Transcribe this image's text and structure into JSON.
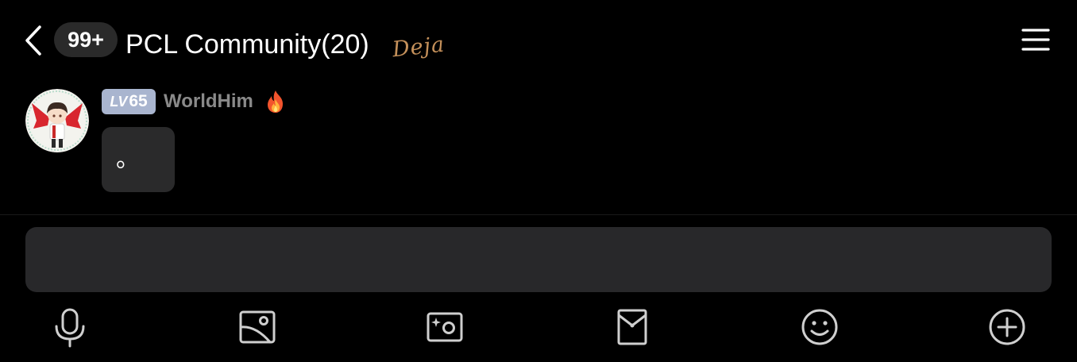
{
  "header": {
    "unread_count": "99+",
    "title": "PCL Community(20)",
    "title_decoration": "Deja",
    "back_icon": "chevron-left-icon",
    "menu_icon": "hamburger-menu-icon"
  },
  "message": {
    "level_prefix": "LV",
    "level_number": "65",
    "sender_name": "WorldHim",
    "sender_emoji": "fire-icon",
    "text": "。"
  },
  "composer": {
    "value": "",
    "placeholder": ""
  },
  "toolbar": {
    "items": [
      {
        "name": "voice",
        "icon": "microphone-icon"
      },
      {
        "name": "image",
        "icon": "image-icon"
      },
      {
        "name": "camera",
        "icon": "camera-icon"
      },
      {
        "name": "red-packet",
        "icon": "red-packet-icon"
      },
      {
        "name": "emoji",
        "icon": "smiley-icon"
      },
      {
        "name": "more",
        "icon": "plus-circle-icon"
      }
    ]
  },
  "colors": {
    "background": "#000000",
    "surface": "#28282a",
    "badge_bg": "#2a2a2a",
    "level_badge": "#a9b5cf",
    "name_gray": "#8a8a8a",
    "title_decoration": "#c4905a",
    "icon_gray": "#cfcfcf"
  }
}
